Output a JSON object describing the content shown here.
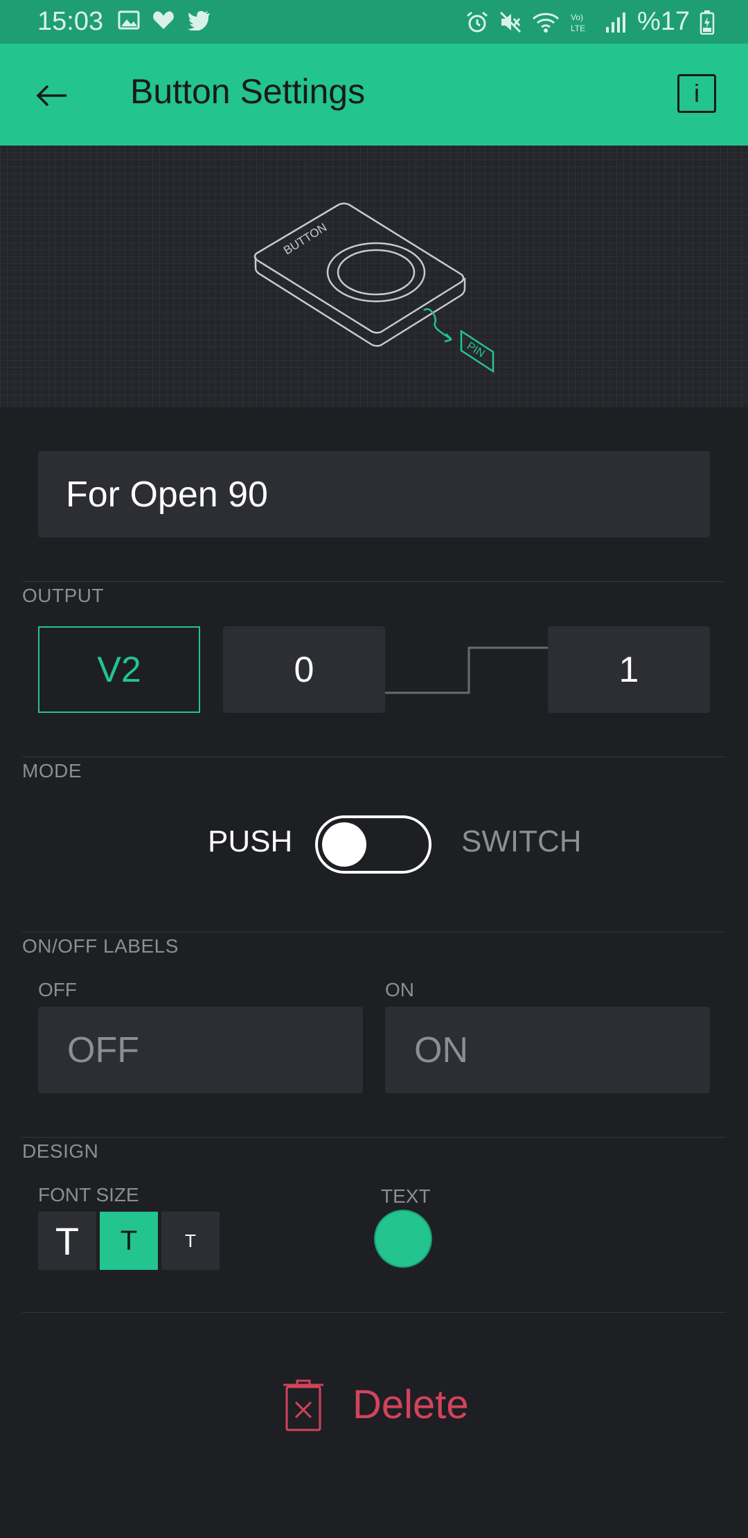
{
  "status_bar": {
    "time": "15:03",
    "left_icons": [
      "image-icon",
      "heart-icon",
      "twitter-icon"
    ],
    "right_icons": [
      "alarm-icon",
      "mute-icon",
      "wifi-icon",
      "volte-icon",
      "signal-icon"
    ],
    "battery": "%17"
  },
  "app_bar": {
    "title": "Button Settings",
    "back_icon": "arrow-left-icon",
    "info_label": "i"
  },
  "illustration": {
    "button_text": "BUTTON",
    "pin_text": "PIN"
  },
  "widget_name": "For Open 90",
  "output": {
    "section_label": "OUTPUT",
    "pin": "V2",
    "off_value": "0",
    "on_value": "1"
  },
  "mode": {
    "section_label": "MODE",
    "left_label": "PUSH",
    "right_label": "SWITCH",
    "selected": "PUSH"
  },
  "labels": {
    "section_label": "ON/OFF LABELS",
    "off_title": "OFF",
    "on_title": "ON",
    "off_value": "OFF",
    "on_value": "ON"
  },
  "design": {
    "section_label": "DESIGN",
    "font_size_label": "FONT SIZE",
    "font_sizes": [
      "T",
      "T",
      "T"
    ],
    "selected_font_size_index": 1,
    "text_label": "TEXT",
    "text_color": "#23c48e"
  },
  "delete_label": "Delete",
  "colors": {
    "accent": "#23c48e",
    "status_bar": "#1f9e73",
    "background": "#1e1f23",
    "field": "#2d2e33",
    "danger": "#d3435c"
  }
}
